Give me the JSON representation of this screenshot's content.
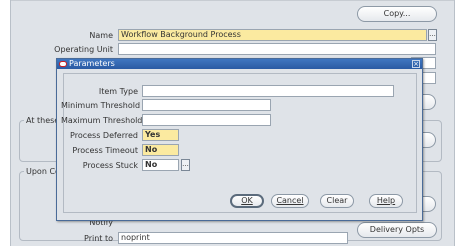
{
  "form": {
    "copy_button": "Copy...",
    "name_label": "Name",
    "name_value": "Workflow Background Process",
    "operating_unit_label": "Operating Unit",
    "region_at_these_title": "At these",
    "region_upon_title": "Upon Co",
    "notify_label": "Notify",
    "print_to_label": "Print to",
    "print_to_value": "noprint",
    "delivery_opts_button": "Delivery Opts",
    "lov_glyph": "..."
  },
  "dialog": {
    "title": "Parameters",
    "close_glyph": "×",
    "fields": [
      {
        "label": "Item Type",
        "value": ""
      },
      {
        "label": "Minimum Threshold",
        "value": ""
      },
      {
        "label": "Maximum Threshold",
        "value": ""
      },
      {
        "label": "Process Deferred",
        "value": "Yes"
      },
      {
        "label": "Process Timeout",
        "value": "No"
      },
      {
        "label": "Process Stuck",
        "value": "No"
      }
    ],
    "ok_button": "OK",
    "cancel_button": "Cancel",
    "clear_button": "Clear",
    "help_button": "Help"
  },
  "colors": {
    "required_field": "#fbeaa0",
    "titlebar": "#2a5aa3",
    "form_background": "#dfe3e8"
  }
}
